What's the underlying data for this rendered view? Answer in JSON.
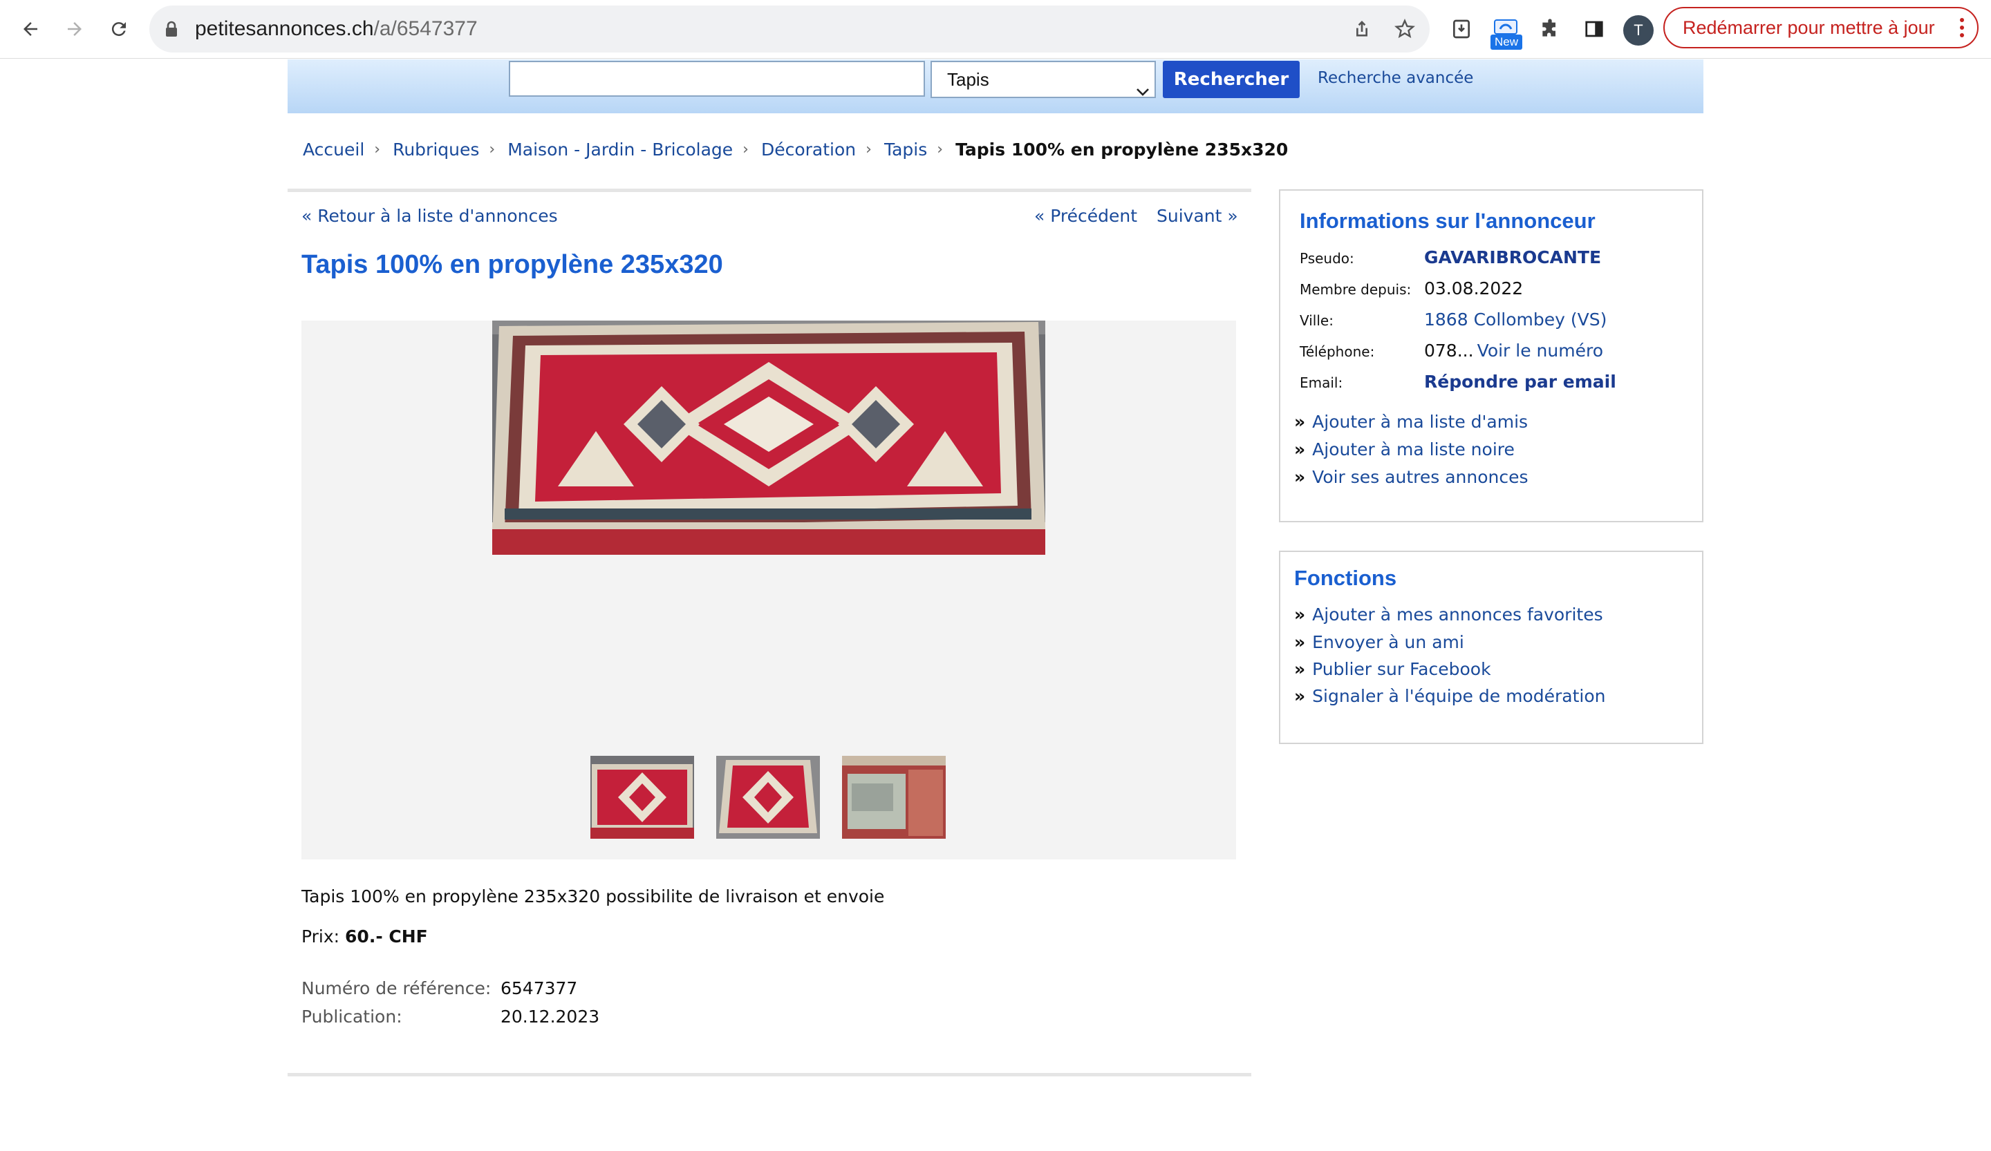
{
  "browser": {
    "url_host": "petitesannonces.ch",
    "url_path": "/a/6547377",
    "new_badge": "New",
    "avatar_letter": "T",
    "restart_label": "Redémarrer pour mettre à jour"
  },
  "search": {
    "input_value": "",
    "category_selected": "Tapis",
    "submit_label": "Rechercher",
    "advanced_link": "Recherche avancée"
  },
  "breadcrumb": {
    "items": [
      "Accueil",
      "Rubriques",
      "Maison - Jardin - Bricolage",
      "Décoration",
      "Tapis"
    ],
    "current": "Tapis 100% en propylène 235x320"
  },
  "ad": {
    "back_link": "« Retour à la liste d'annonces",
    "prev_link": "« Précédent",
    "next_link": "Suivant »",
    "title": "Tapis 100% en propylène 235x320",
    "description": "Tapis 100% en propylène 235x320 possibilite de livraison et envoie",
    "price_label": "Prix:",
    "price_value": "60.- CHF",
    "reference_label": "Numéro de référence:",
    "reference_value": "6547377",
    "publication_label": "Publication:",
    "publication_value": "20.12.2023"
  },
  "advertiser": {
    "heading": "Informations sur l'annonceur",
    "pseudo_label": "Pseudo:",
    "pseudo_value": "GAVARIBROCANTE",
    "member_label": "Membre depuis:",
    "member_value": "03.08.2022",
    "city_label": "Ville:",
    "city_value": "1868 Collombey (VS)",
    "phone_label": "Téléphone:",
    "phone_value": "078...",
    "phone_link": "Voir le numéro",
    "email_label": "Email:",
    "email_link": "Répondre par email",
    "actions": [
      "Ajouter à ma liste d'amis",
      "Ajouter à ma liste noire",
      "Voir ses autres annonces"
    ]
  },
  "functions": {
    "heading": "Fonctions",
    "actions": [
      "Ajouter à mes annonces favorites",
      "Envoyer à un ami",
      "Publier sur Facebook",
      "Signaler à l'équipe de modération"
    ]
  },
  "colors": {
    "link": "#1a4a9a",
    "title_blue": "#1a5fd0",
    "search_button": "#1f4fc7",
    "restart_red": "#c5221f",
    "carpet_red": "#c4203a"
  },
  "icons": [
    "back-arrow-icon",
    "forward-arrow-icon",
    "reload-icon",
    "lock-icon",
    "share-icon",
    "star-icon",
    "extension-icon",
    "puzzle-icon",
    "side-panel-icon",
    "kebab-menu-icon",
    "chevron-down-icon"
  ]
}
